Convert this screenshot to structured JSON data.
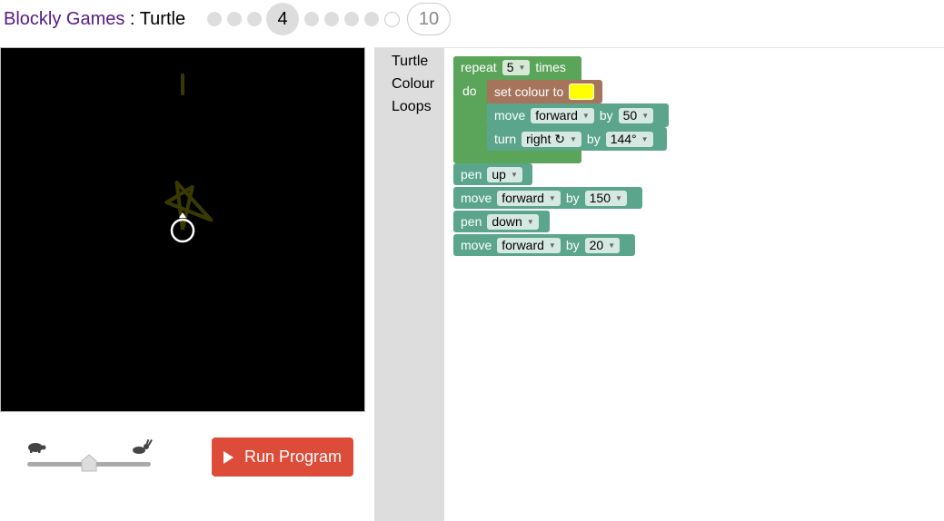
{
  "header": {
    "games_link": "Blockly Games",
    "separator": " : ",
    "app_name": "Turtle",
    "current_level": "4",
    "max_level": "10"
  },
  "toolbox": {
    "categories": [
      "Turtle",
      "Colour",
      "Loops"
    ]
  },
  "controls": {
    "run_label": "Run Program"
  },
  "blocks": {
    "repeat": {
      "kw": "repeat",
      "count": "5",
      "times": "times",
      "do": "do"
    },
    "set_colour": {
      "label": "set colour to",
      "colour": "#ffff00"
    },
    "move1": {
      "kw": "move",
      "dir": "forward",
      "by": "by",
      "value": "50"
    },
    "turn1": {
      "kw": "turn",
      "dir": "right ↻",
      "by": "by",
      "value": "144°"
    },
    "pen1": {
      "kw": "pen",
      "value": "up"
    },
    "move2": {
      "kw": "move",
      "dir": "forward",
      "by": "by",
      "value": "150"
    },
    "pen2": {
      "kw": "pen",
      "value": "down"
    },
    "move3": {
      "kw": "move",
      "dir": "forward",
      "by": "by",
      "value": "20"
    }
  },
  "colors": {
    "loop_block": "#5ba55b",
    "turtle_block": "#5ba58c",
    "colour_block": "#a5745b",
    "run_button": "#dd4b39",
    "games_link": "#551a8b"
  },
  "icons": [
    "turtle-icon",
    "rabbit-icon",
    "play-icon",
    "turtle-cursor-icon"
  ]
}
